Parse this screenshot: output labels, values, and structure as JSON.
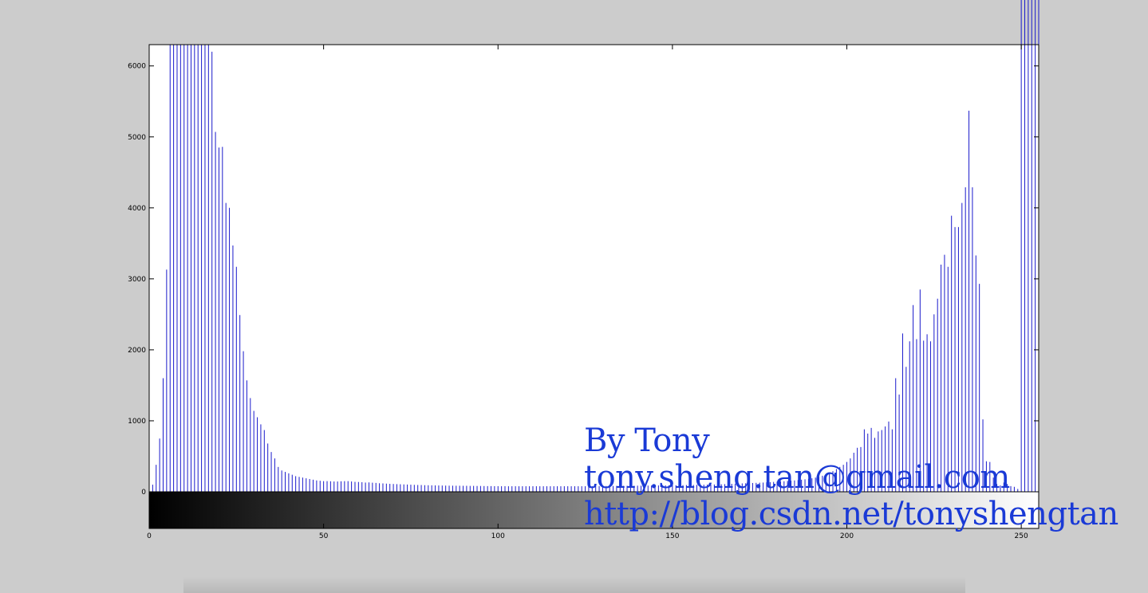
{
  "chart_data": {
    "type": "bar",
    "title": "",
    "xlabel": "",
    "ylabel": "",
    "xlim": [
      0,
      255
    ],
    "ylim": [
      0,
      6300
    ],
    "colorbar_ylim": [
      -500,
      0
    ],
    "x_ticks": [
      0,
      50,
      100,
      150,
      200,
      250
    ],
    "y_ticks": [
      0,
      1000,
      2000,
      3000,
      4000,
      5000,
      6000
    ],
    "bar_color": "#1a1acc",
    "grid": false,
    "x": [
      1,
      2,
      3,
      4,
      5,
      6,
      7,
      8,
      9,
      10,
      11,
      12,
      13,
      14,
      15,
      16,
      17,
      18,
      19,
      20,
      21,
      22,
      23,
      24,
      25,
      26,
      27,
      28,
      29,
      30,
      31,
      32,
      33,
      34,
      35,
      36,
      37,
      38,
      39,
      40,
      41,
      42,
      43,
      44,
      45,
      46,
      47,
      48,
      49,
      50,
      51,
      52,
      53,
      54,
      55,
      56,
      57,
      58,
      59,
      60,
      61,
      62,
      63,
      64,
      65,
      66,
      67,
      68,
      69,
      70,
      71,
      72,
      73,
      74,
      75,
      76,
      77,
      78,
      79,
      80,
      81,
      82,
      83,
      84,
      85,
      86,
      87,
      88,
      89,
      90,
      91,
      92,
      93,
      94,
      95,
      96,
      97,
      98,
      99,
      100,
      101,
      102,
      103,
      104,
      105,
      106,
      107,
      108,
      109,
      110,
      111,
      112,
      113,
      114,
      115,
      116,
      117,
      118,
      119,
      120,
      121,
      122,
      123,
      124,
      125,
      126,
      127,
      128,
      129,
      130,
      131,
      132,
      133,
      134,
      135,
      136,
      137,
      138,
      139,
      140,
      141,
      142,
      143,
      144,
      145,
      146,
      147,
      148,
      149,
      150,
      151,
      152,
      153,
      154,
      155,
      156,
      157,
      158,
      159,
      160,
      161,
      162,
      163,
      164,
      165,
      166,
      167,
      168,
      169,
      170,
      171,
      172,
      173,
      174,
      175,
      176,
      177,
      178,
      179,
      180,
      181,
      182,
      183,
      184,
      185,
      186,
      187,
      188,
      189,
      190,
      191,
      192,
      193,
      194,
      195,
      196,
      197,
      198,
      199,
      200,
      201,
      202,
      203,
      204,
      205,
      206,
      207,
      208,
      209,
      210,
      211,
      212,
      213,
      214,
      215,
      216,
      217,
      218,
      219,
      220,
      221,
      222,
      223,
      224,
      225,
      226,
      227,
      228,
      229,
      230,
      231,
      232,
      233,
      234,
      235,
      236,
      237,
      238,
      239,
      240,
      241,
      242,
      243,
      244,
      245,
      246,
      247,
      248,
      249,
      250,
      251,
      252,
      253,
      254,
      255
    ],
    "values": [
      100,
      380,
      750,
      1600,
      3130,
      6300,
      6300,
      6300,
      6300,
      6300,
      6300,
      6300,
      6300,
      6300,
      6300,
      6300,
      6300,
      6200,
      5070,
      4850,
      4860,
      4070,
      4000,
      3470,
      3170,
      2490,
      1980,
      1570,
      1320,
      1140,
      1050,
      950,
      870,
      680,
      560,
      470,
      350,
      300,
      280,
      260,
      240,
      220,
      210,
      200,
      190,
      180,
      170,
      160,
      155,
      150,
      150,
      148,
      145,
      145,
      148,
      150,
      150,
      145,
      140,
      138,
      135,
      130,
      132,
      128,
      125,
      120,
      118,
      115,
      112,
      110,
      108,
      106,
      104,
      102,
      100,
      98,
      96,
      95,
      93,
      92,
      91,
      90,
      89,
      88,
      87,
      86,
      86,
      85,
      85,
      84,
      84,
      83,
      83,
      82,
      82,
      81,
      80,
      80,
      79,
      79,
      78,
      78,
      78,
      78,
      78,
      78,
      78,
      78,
      78,
      78,
      78,
      78,
      78,
      78,
      78,
      78,
      78,
      78,
      78,
      78,
      78,
      78,
      78,
      78,
      78,
      79,
      79,
      80,
      80,
      81,
      81,
      82,
      82,
      83,
      83,
      84,
      84,
      85,
      85,
      86,
      86,
      87,
      87,
      88,
      88,
      89,
      89,
      90,
      90,
      91,
      92,
      93,
      94,
      95,
      96,
      97,
      98,
      99,
      100,
      101,
      102,
      103,
      104,
      106,
      108,
      110,
      112,
      114,
      116,
      118,
      120,
      122,
      124,
      126,
      128,
      130,
      133,
      136,
      139,
      142,
      145,
      148,
      152,
      156,
      160,
      165,
      170,
      176,
      182,
      190,
      200,
      212,
      226,
      242,
      260,
      290,
      320,
      350,
      380,
      420,
      470,
      550,
      620,
      630,
      880,
      820,
      900,
      760,
      850,
      870,
      920,
      990,
      880,
      1600,
      1370,
      2230,
      1760,
      2120,
      2630,
      2150,
      2850,
      2130,
      2220,
      2120,
      2500,
      2720,
      3200,
      3340,
      3170,
      3890,
      3730,
      3730,
      4070,
      4290,
      5370,
      4290,
      3330,
      2930,
      1020,
      430,
      420,
      200,
      110,
      90,
      130,
      110,
      80,
      70,
      40
    ]
  },
  "watermark": {
    "line1": "By Tony",
    "line2": "tony.sheng.tan@gmail.com",
    "line3": "http://blog.csdn.net/tonyshengtan",
    "color": "#1a3ad6"
  }
}
